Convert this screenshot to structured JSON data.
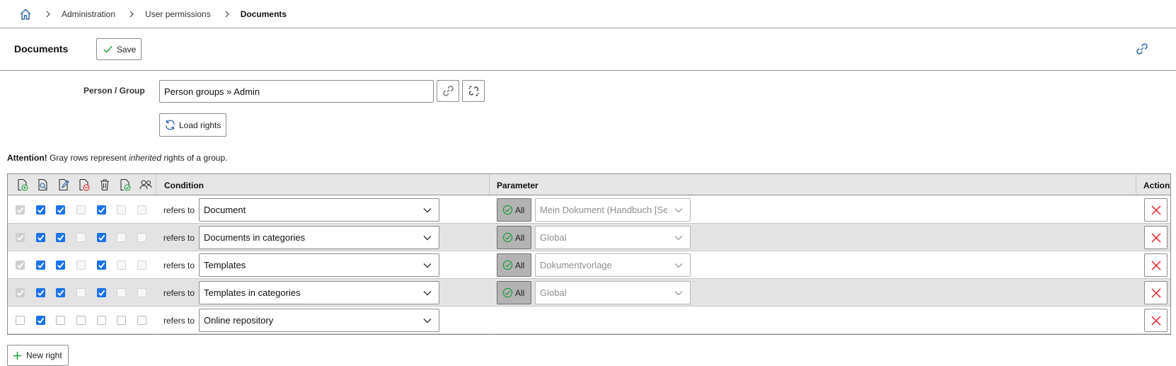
{
  "breadcrumb": {
    "home_icon": "home-icon",
    "items": [
      "Administration",
      "User permissions"
    ],
    "current": "Documents"
  },
  "header": {
    "title": "Documents",
    "save_label": "Save",
    "link_icon": "link-icon"
  },
  "person_group": {
    "label": "Person / Group",
    "value": "Person groups » Admin",
    "load_label": "Load rights"
  },
  "attention": {
    "bold": "Attention!",
    "text_before": " Gray rows represent ",
    "italic": "inherited",
    "text_after": " rights of a group."
  },
  "table": {
    "permission_icons": [
      "create-icon",
      "view-icon",
      "edit-icon",
      "archive-icon",
      "delete-icon",
      "approve-icon",
      "supervisor-icon"
    ],
    "headers": {
      "condition": "Condition",
      "parameter": "Parameter",
      "action": "Action"
    },
    "rows": [
      {
        "inherited": true,
        "perms": [
          "on-dis",
          "on",
          "on",
          "off-dis",
          "on",
          "off-dis",
          "off-dis"
        ],
        "refers": "refers to",
        "condition": "Document",
        "all_label": "All",
        "parameter": "Mein Dokument (Handbuch [Ser"
      },
      {
        "inherited": true,
        "perms": [
          "on-dis",
          "on",
          "on",
          "off-dis",
          "on",
          "off-dis",
          "off-dis"
        ],
        "refers": "refers to",
        "condition": "Documents in categories",
        "all_label": "All",
        "parameter": "Global"
      },
      {
        "inherited": false,
        "perms": [
          "on-dis",
          "on",
          "on",
          "off-dis",
          "on",
          "off-dis",
          "off-dis"
        ],
        "refers": "refers to",
        "condition": "Templates",
        "all_label": "All",
        "parameter": "Dokumentvorlage"
      },
      {
        "inherited": true,
        "perms": [
          "on-dis",
          "on",
          "on",
          "off-dis",
          "on",
          "off-dis",
          "off-dis"
        ],
        "refers": "refers to",
        "condition": "Templates in categories",
        "all_label": "All",
        "parameter": "Global"
      },
      {
        "inherited": false,
        "perms": [
          "off",
          "on",
          "off",
          "off",
          "off",
          "off",
          "off"
        ],
        "refers": "refers to",
        "condition": "Online repository",
        "all_label": null,
        "parameter": null
      }
    ]
  },
  "footer": {
    "new_right_label": "New right"
  },
  "colors": {
    "accent": "#1a73e8",
    "link": "#2a62a6",
    "delete": "#e0202a",
    "ok_green": "#1f9d3a",
    "inherited_row": "#e3e3e3"
  }
}
